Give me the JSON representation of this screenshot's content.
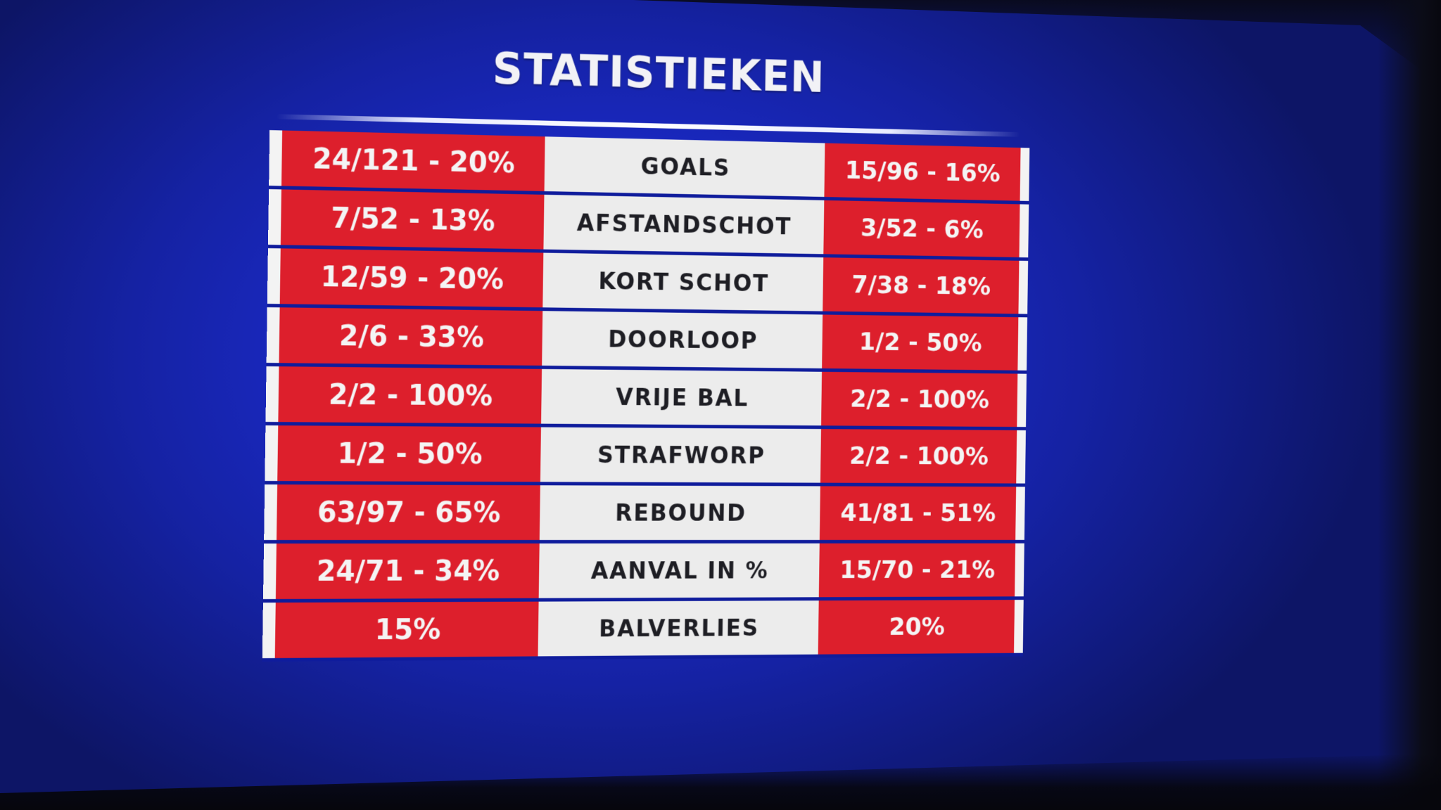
{
  "title": "STATISTIEKEN",
  "colors": {
    "background": "#1a29c4",
    "team_cell": "#dd1f2c",
    "label_cell": "#ececec",
    "text_light": "#f4f4f4",
    "text_dark": "#1e1e24"
  },
  "rows": [
    {
      "left": "24/121 - 20%",
      "label": "GOALS",
      "right": "15/96 - 16%"
    },
    {
      "left": "7/52 - 13%",
      "label": "AFSTANDSCHOT",
      "right": "3/52 - 6%"
    },
    {
      "left": "12/59 - 20%",
      "label": "KORT SCHOT",
      "right": "7/38 - 18%"
    },
    {
      "left": "2/6 - 33%",
      "label": "DOORLOOP",
      "right": "1/2 - 50%"
    },
    {
      "left": "2/2 - 100%",
      "label": "VRIJE BAL",
      "right": "2/2 - 100%"
    },
    {
      "left": "1/2 - 50%",
      "label": "STRAFWORP",
      "right": "2/2 - 100%"
    },
    {
      "left": "63/97 - 65%",
      "label": "REBOUND",
      "right": "41/81 - 51%"
    },
    {
      "left": "24/71 - 34%",
      "label": "AANVAL IN %",
      "right": "15/70 - 21%"
    },
    {
      "left": "15%",
      "label": "BALVERLIES",
      "right": "20%"
    }
  ]
}
